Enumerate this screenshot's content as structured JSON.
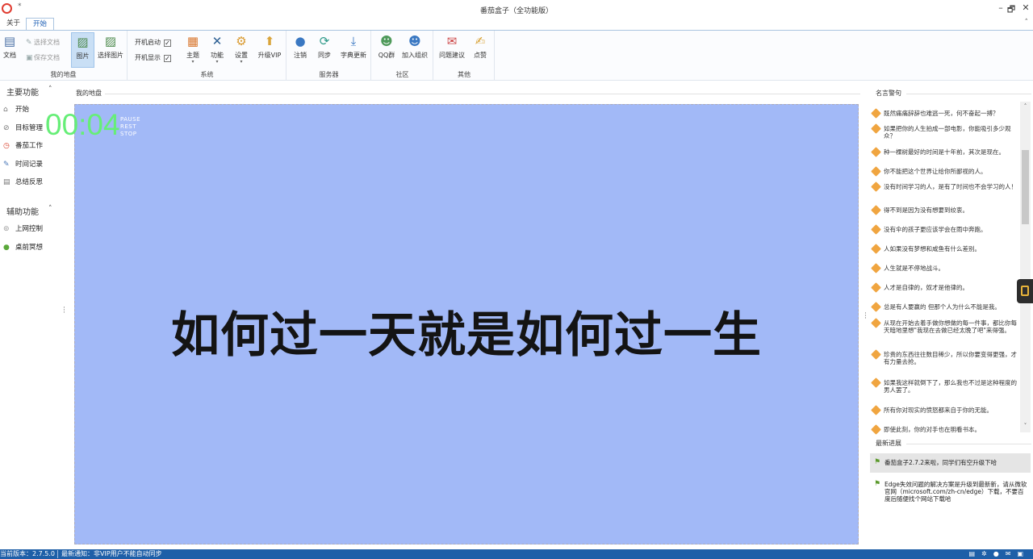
{
  "window": {
    "title": "番茄盒子（全功能版）",
    "quick_access_icon": "star-icon",
    "minimize": "–",
    "restore": "🗗",
    "close": "✕"
  },
  "tabs": [
    {
      "label": "关于"
    },
    {
      "label": "开始"
    }
  ],
  "ribbon_collapse": "˄",
  "ribbon": {
    "groups": [
      {
        "label": "我的地盘"
      },
      {
        "label": "系统"
      },
      {
        "label": "服务器"
      },
      {
        "label": "社区"
      },
      {
        "label": "其他"
      }
    ],
    "doc": {
      "label": "文档",
      "icon": "document-icon"
    },
    "select_doc": {
      "label": "选择文档",
      "icon": "select-doc-icon"
    },
    "save_doc": {
      "label": "保存文档",
      "icon": "save-icon"
    },
    "picture": {
      "label": "图片",
      "icon": "picture-icon"
    },
    "select_picture": {
      "label": "选择图片",
      "icon": "select-picture-icon"
    },
    "autostart": {
      "label": "开机启动",
      "checked": true
    },
    "autoshow": {
      "label": "开机显示",
      "checked": true
    },
    "theme": {
      "label": "主题",
      "icon": "theme-icon"
    },
    "features": {
      "label": "功能",
      "icon": "tools-icon"
    },
    "settings": {
      "label": "设置",
      "icon": "settings-icon"
    },
    "upgrade": {
      "label": "升级VIP",
      "icon": "upgrade-icon"
    },
    "logout": {
      "label": "注销",
      "icon": "user-icon"
    },
    "sync": {
      "label": "同步",
      "icon": "sync-icon"
    },
    "dict_update": {
      "label": "字典更新",
      "icon": "download-icon"
    },
    "qq_group": {
      "label": "QQ群",
      "icon": "group-icon"
    },
    "join_org": {
      "label": "加入组织",
      "icon": "join-icon"
    },
    "feedback": {
      "label": "问题建议",
      "icon": "feedback-icon"
    },
    "like": {
      "label": "点赞",
      "icon": "like-icon"
    }
  },
  "sidebar": {
    "main_section": {
      "label": "主要功能",
      "chevron": "˄"
    },
    "main_items": [
      {
        "label": "开始",
        "icon": "home-icon"
      },
      {
        "label": "目标管理",
        "icon": "target-icon"
      },
      {
        "label": "番茄工作",
        "icon": "clock-icon"
      },
      {
        "label": "时间记录",
        "icon": "record-icon"
      },
      {
        "label": "总结反思",
        "icon": "summary-icon"
      }
    ],
    "aux_section": {
      "label": "辅助功能",
      "chevron": "˄"
    },
    "aux_items": [
      {
        "label": "上网控制",
        "icon": "network-icon"
      },
      {
        "label": "桌前冥想",
        "icon": "meditation-icon"
      }
    ]
  },
  "main": {
    "caption": "我的地盘",
    "motto": "如何过一天就是如何过一生",
    "timer": "00:04",
    "timer_controls": [
      "PAUSE",
      "REST",
      "STOP"
    ],
    "background_color": "#a2b9f7"
  },
  "quotes_panel": {
    "caption": "名言警句",
    "items": [
      "既然痛痛辞辞也难逃一死，何不奋起一搏？",
      "如果把你的人生拍成一部电影，你能吸引多少观众？",
      "种一棵树最好的时间是十年前，其次是现在。",
      "你不能把这个世界让给你所鄙视的人。",
      "没有时间学习的人，是有了时间也不会学习的人！",
      "得不到是因为没有想要到绞衷。",
      "没有伞的孩子更应该学会在雨中奔跑。",
      "人如果没有梦想和咸鱼有什么差别。",
      "人生就是不停地战斗。",
      "人才是自律的，奴才是他律的。",
      "总是有人要赢的 但那个人为什么不能是我。",
      "从现在开始去着手做你想做的每一件事，都比你每天暗地里想\"我现在去做已经太晚了吧\"来得强。",
      "珍贵的东西往往数目稀少，所以你要变得更强，才有力量去抢。",
      "如果我这样就倒下了，那么我也不过是这种程度的男人罢了。",
      "所有你对现实的愤怒都来自于你的无能。",
      "即使此刻，你的对手也在明看书本。"
    ]
  },
  "updates_panel": {
    "caption": "最新进展",
    "items": [
      "番茄盒子2.7.2来啦，同学们有空升级下哈",
      "Edge失效问题的解决方案是升级到最新新，请从微软官网（microsoft.com/zh-cn/edge）下载，不要百度后随便找个网站下载哈"
    ]
  },
  "status": {
    "version": "当前版本：2.7.5.0",
    "notice": "最新通知：非VIP用户不能自动同步",
    "icons": [
      "clipboard-icon",
      "settings-icon",
      "pin-icon",
      "mail-icon",
      "lock-icon"
    ]
  }
}
